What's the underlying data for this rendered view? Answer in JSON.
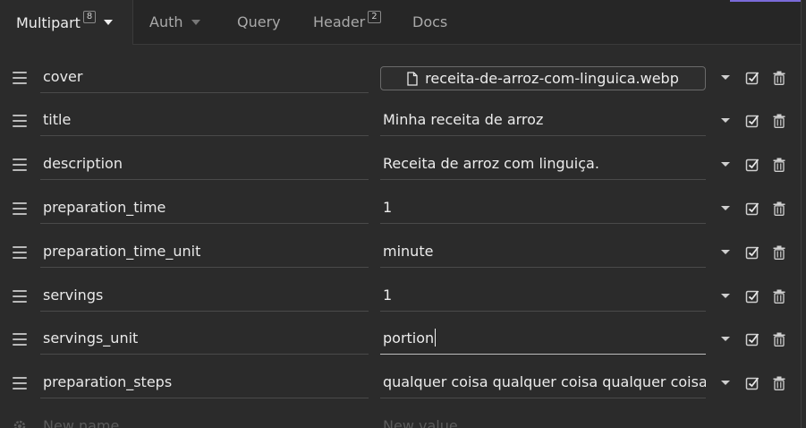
{
  "tabs": {
    "multipart": {
      "label": "Multipart",
      "count": "8"
    },
    "auth": {
      "label": "Auth"
    },
    "query": {
      "label": "Query"
    },
    "header": {
      "label": "Header",
      "count": "2"
    },
    "docs": {
      "label": "Docs"
    }
  },
  "rows": [
    {
      "name": "cover",
      "value": "receita-de-arroz-com-linguica.webp"
    },
    {
      "name": "title",
      "value": "Minha receita de arroz"
    },
    {
      "name": "description",
      "value": "Receita de arroz com linguiça."
    },
    {
      "name": "preparation_time",
      "value": "1"
    },
    {
      "name": "preparation_time_unit",
      "value": "minute"
    },
    {
      "name": "servings",
      "value": "1"
    },
    {
      "name": "servings_unit",
      "value": "portion"
    },
    {
      "name": "preparation_steps",
      "value": "qualquer coisa qualquer coisa qualquer coisa qualquer coisa"
    }
  ],
  "new_row": {
    "name_placeholder": "New name",
    "value_placeholder": "New value"
  },
  "colors": {
    "background": "#2b2b2b",
    "accent": "#7a6ad8",
    "text": "#e6e6e6"
  },
  "icons": {
    "drag": "drag-handle-icon",
    "file": "file-icon",
    "dropdown": "chevron-down-icon",
    "checkbox": "checkbox-checked-icon",
    "delete": "trash-icon",
    "settings": "gear-icon"
  }
}
